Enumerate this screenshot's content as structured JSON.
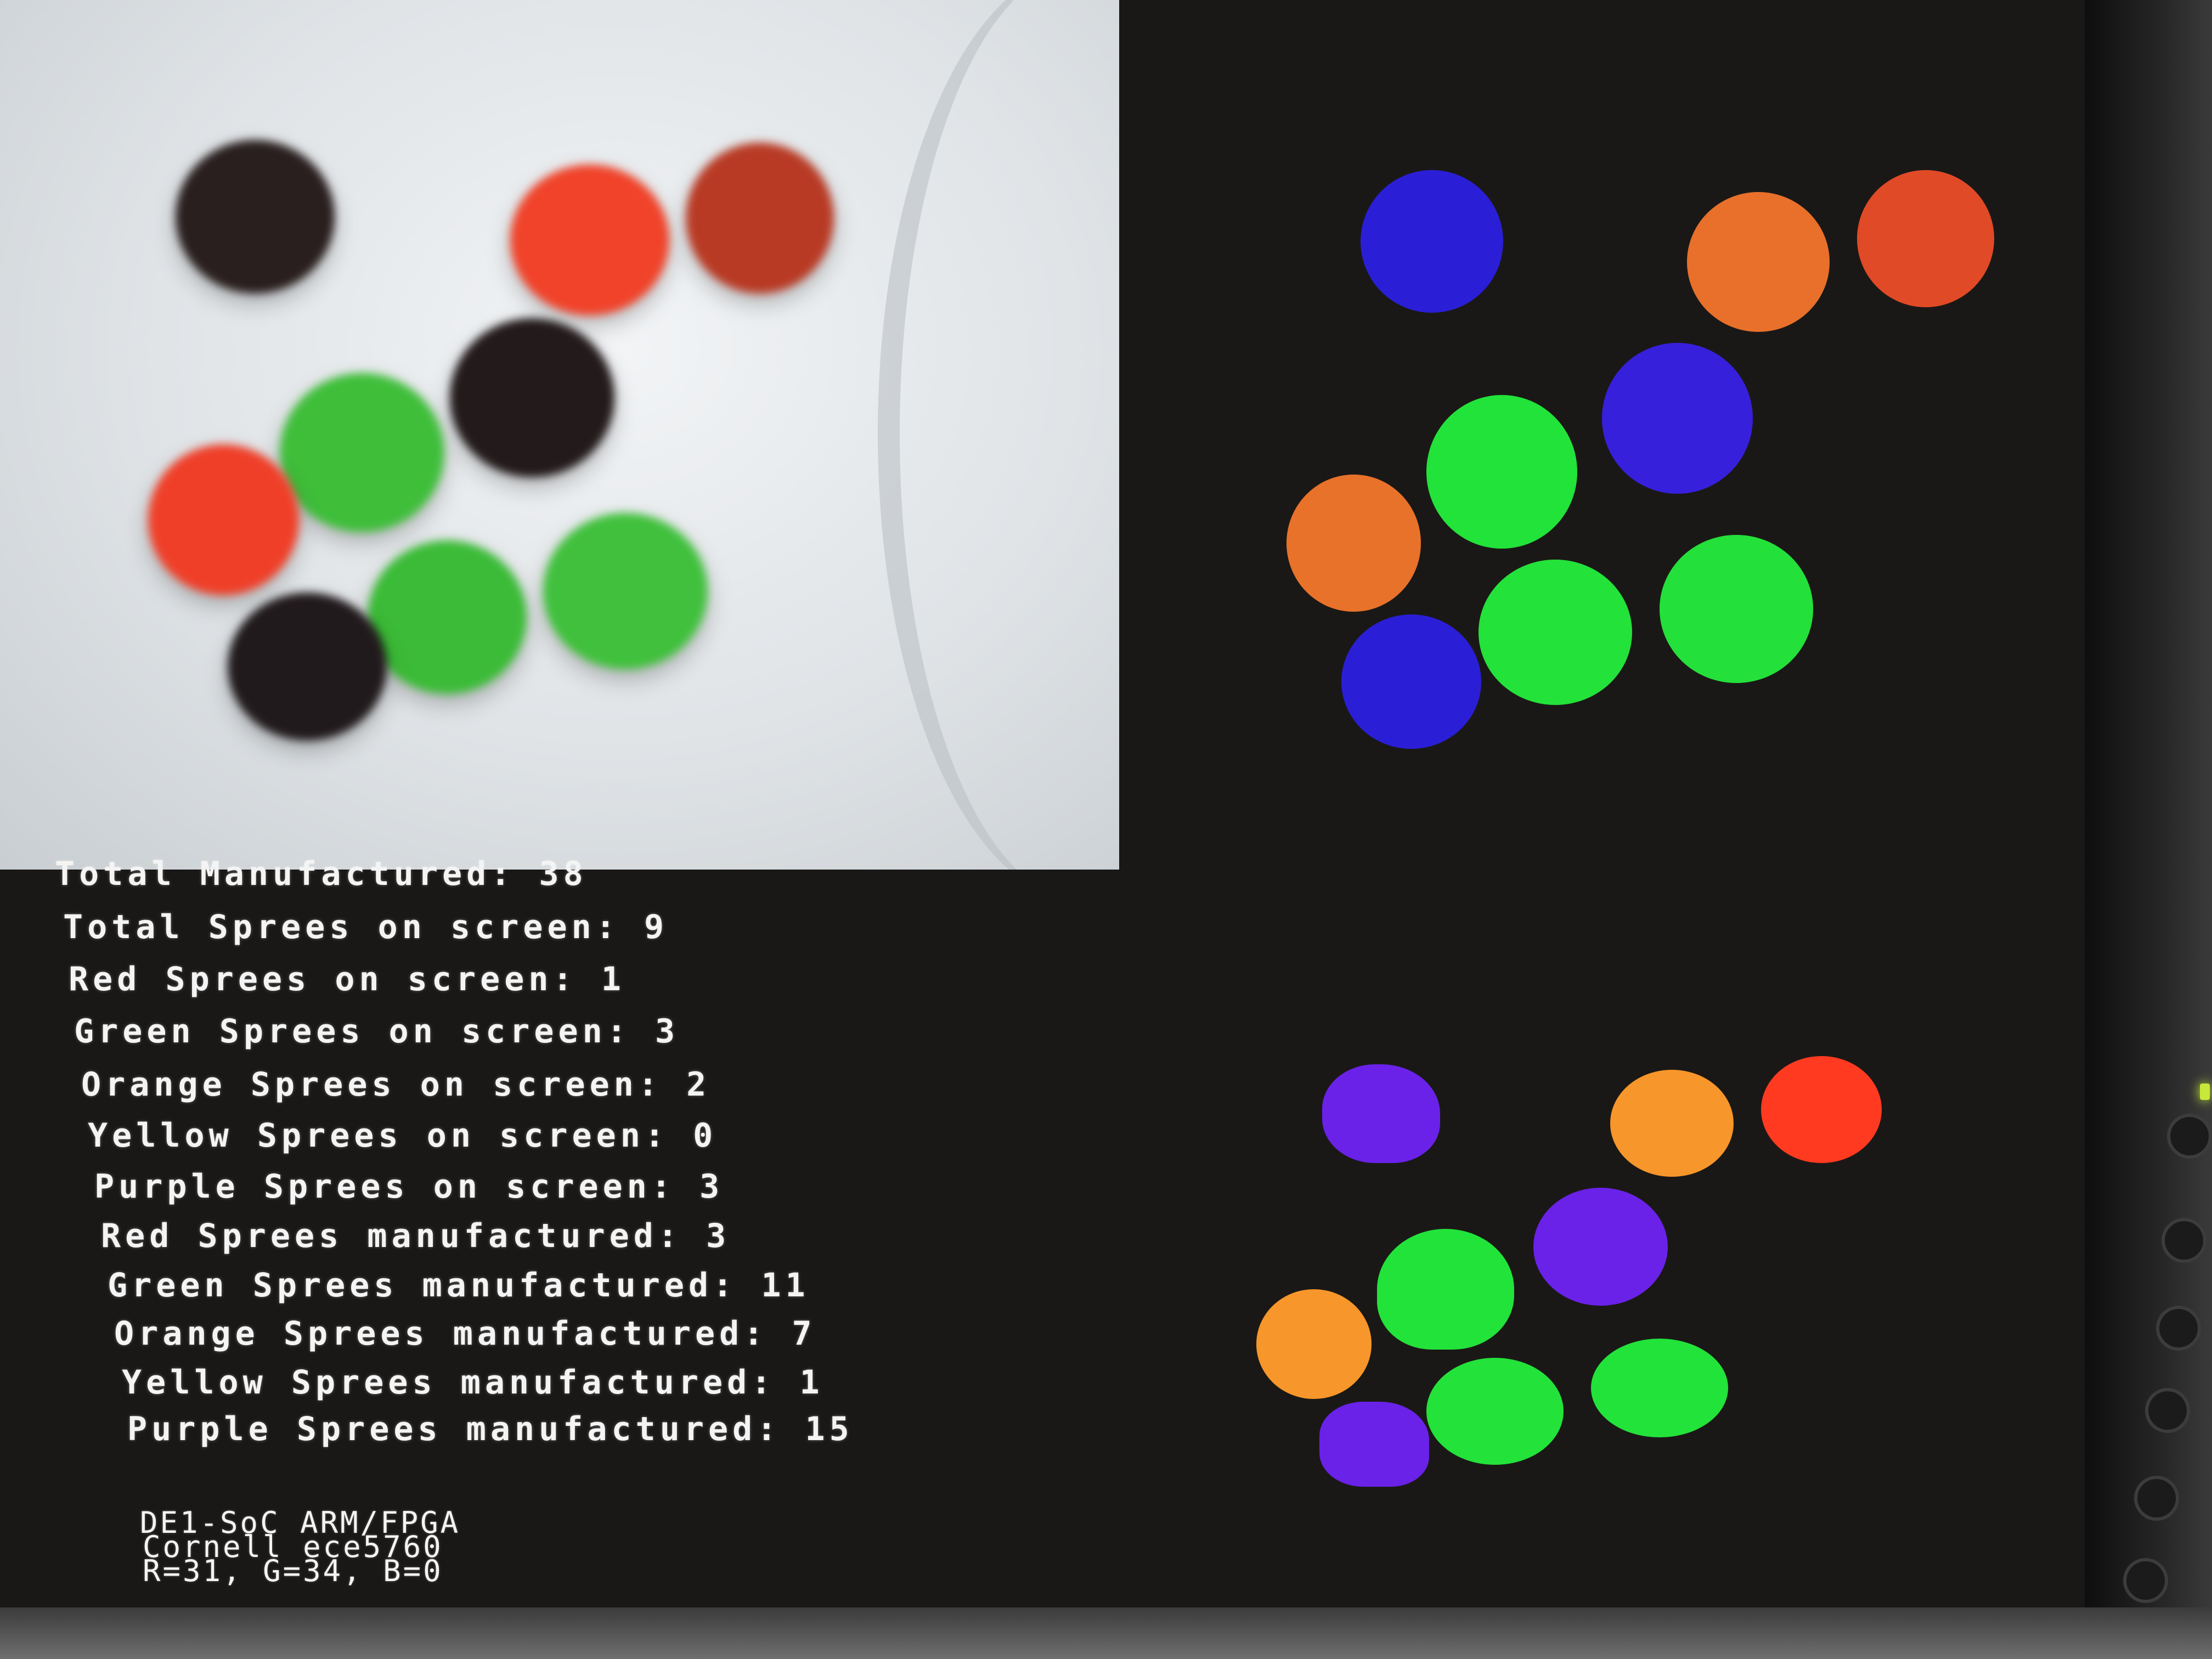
{
  "stats": {
    "total_manufactured": "Total Manufactured: 38",
    "total_on_screen": "Total Sprees on screen: 9",
    "red_on_screen": "Red Sprees on screen: 1",
    "green_on_screen": "Green Sprees on screen: 3",
    "orange_on_screen": "Orange Sprees on screen: 2",
    "yellow_on_screen": "Yellow Sprees on screen: 0",
    "purple_on_screen": "Purple Sprees on screen: 3",
    "red_manufactured": "Red Sprees manufactured: 3",
    "green_manufactured": "Green Sprees manufactured: 11",
    "orange_manufactured": "Orange Sprees manufactured: 7",
    "yellow_manufactured": "Yellow Sprees manufactured: 1",
    "purple_manufactured": "Purple Sprees manufactured: 15"
  },
  "footer": {
    "line1": "DE1-SoC ARM/FPGA",
    "line2": "Cornell ece5760",
    "line3": "R=31, G=34, B=0"
  },
  "colors": {
    "black_candy": "#2a1f1f",
    "red_candy": "#f0432a",
    "dark_red_candy": "#b83a24",
    "green_candy": "#3fbe3a",
    "seg_blue": "#2a1fd6",
    "seg_orange": "#e8702a",
    "seg_red": "#e04a26",
    "seg_green": "#22e33a",
    "seg_purple": "#6a22e8",
    "seg_orange_light": "#f7962a",
    "seg_red_bright": "#ff3a20"
  }
}
